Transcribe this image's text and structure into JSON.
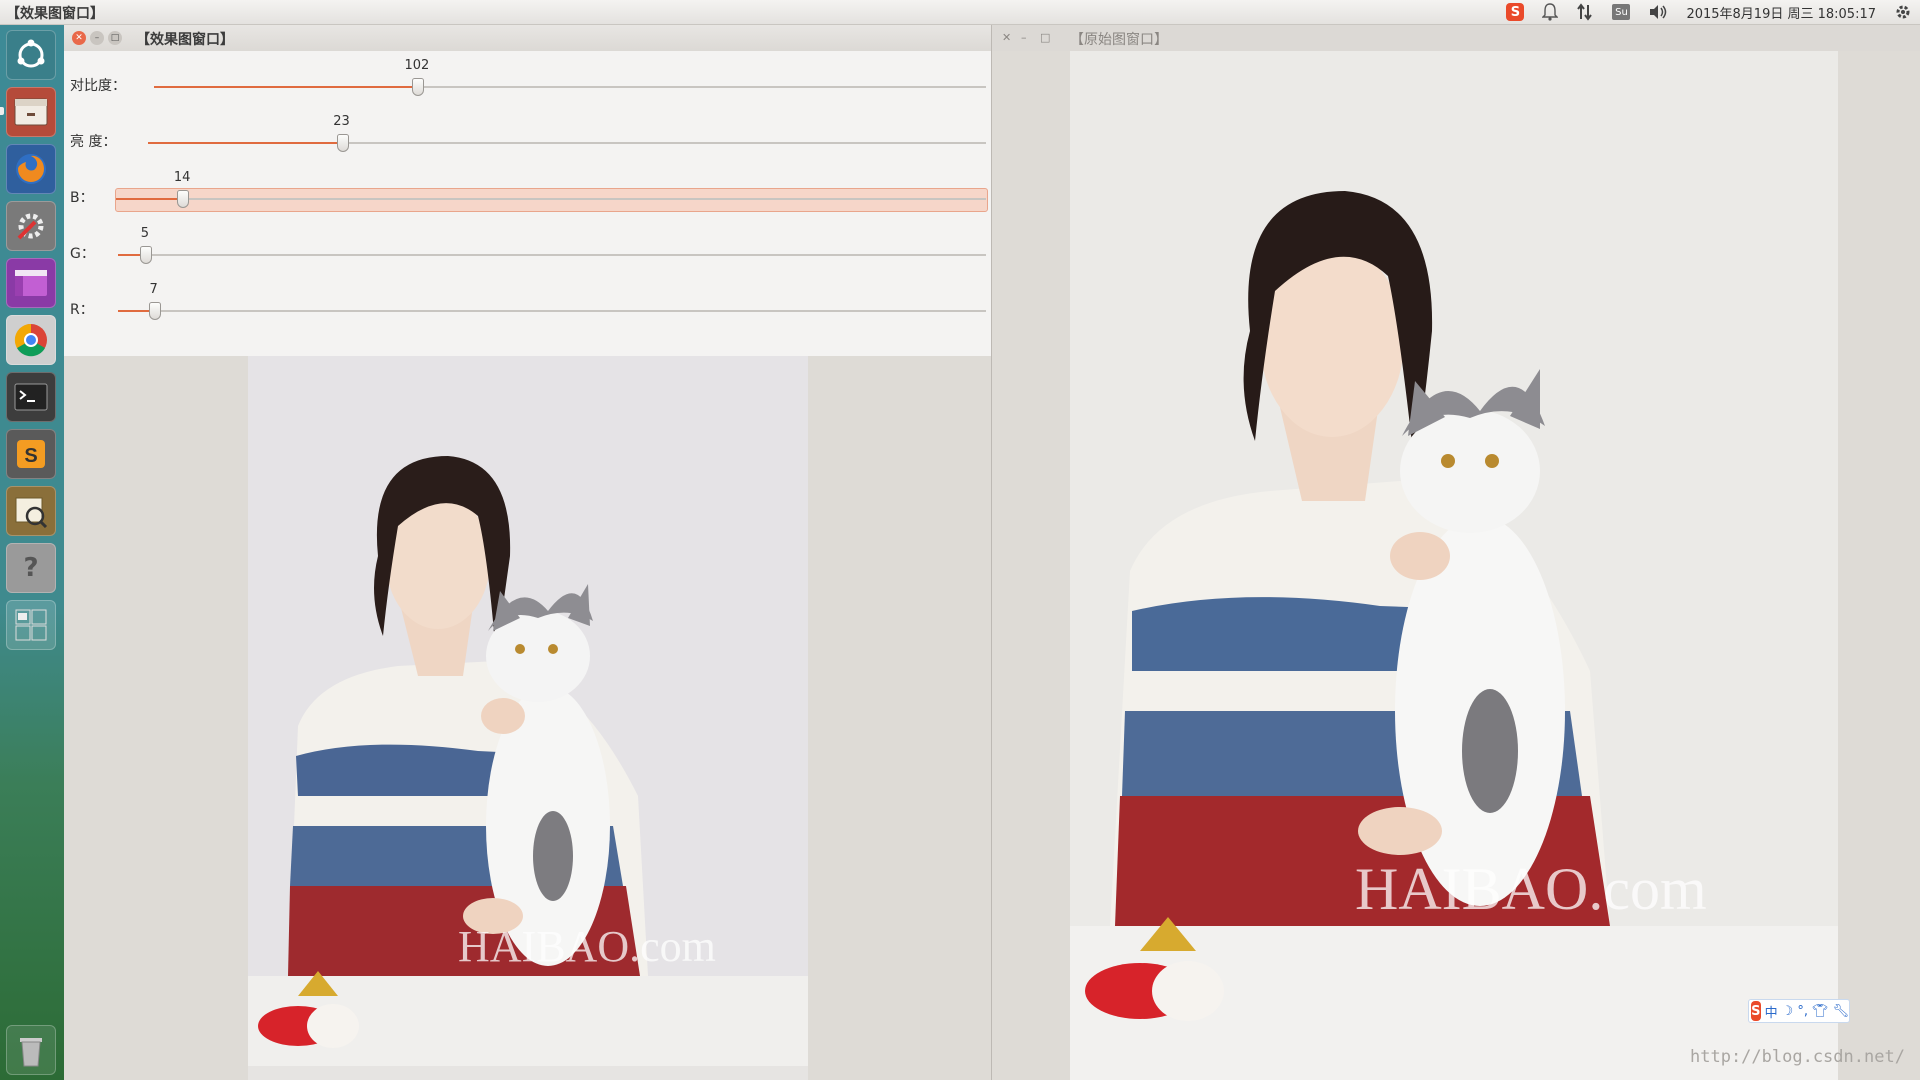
{
  "top_panel": {
    "active_title": "【效果图窗口】",
    "clock": "2015年8月19日 周三 18:05:17",
    "tray_icons": [
      "sogou-input-icon",
      "bell-icon",
      "network-arrows-icon",
      "user-icon",
      "volume-icon",
      "gear-icon"
    ],
    "sogou_letter": "S",
    "user_label": "Su"
  },
  "launcher": {
    "items": [
      "ubuntu-dash-icon",
      "file-manager-icon",
      "firefox-icon",
      "system-settings-icon",
      "workspace-switcher-app-icon",
      "chrome-icon",
      "terminal-icon",
      "sublime-text-icon",
      "image-viewer-icon",
      "help-icon",
      "workspaces-icon",
      "trash-icon"
    ]
  },
  "effect_window": {
    "title": "【效果图窗口】",
    "sliders": [
      {
        "label": "对比度：",
        "value": "102",
        "fraction": 0.316
      },
      {
        "label": "亮  度：",
        "value": "23",
        "fraction": 0.231
      },
      {
        "label": "B：",
        "value": "14",
        "fraction": 0.076
      },
      {
        "label": "G：",
        "value": "5",
        "fraction": 0.031
      },
      {
        "label": "R：",
        "value": "7",
        "fraction": 0.041
      }
    ],
    "watermark": "HAIBAO.com"
  },
  "original_window": {
    "title": "【原始图窗口】",
    "watermark": "HAIBAO.com"
  },
  "ime_bar": {
    "mode": "中",
    "icons": [
      "moon-icon",
      "punctuation-icon",
      "shirt-icon",
      "wrench-icon"
    ]
  },
  "page_watermark": "http://blog.csdn.net/"
}
